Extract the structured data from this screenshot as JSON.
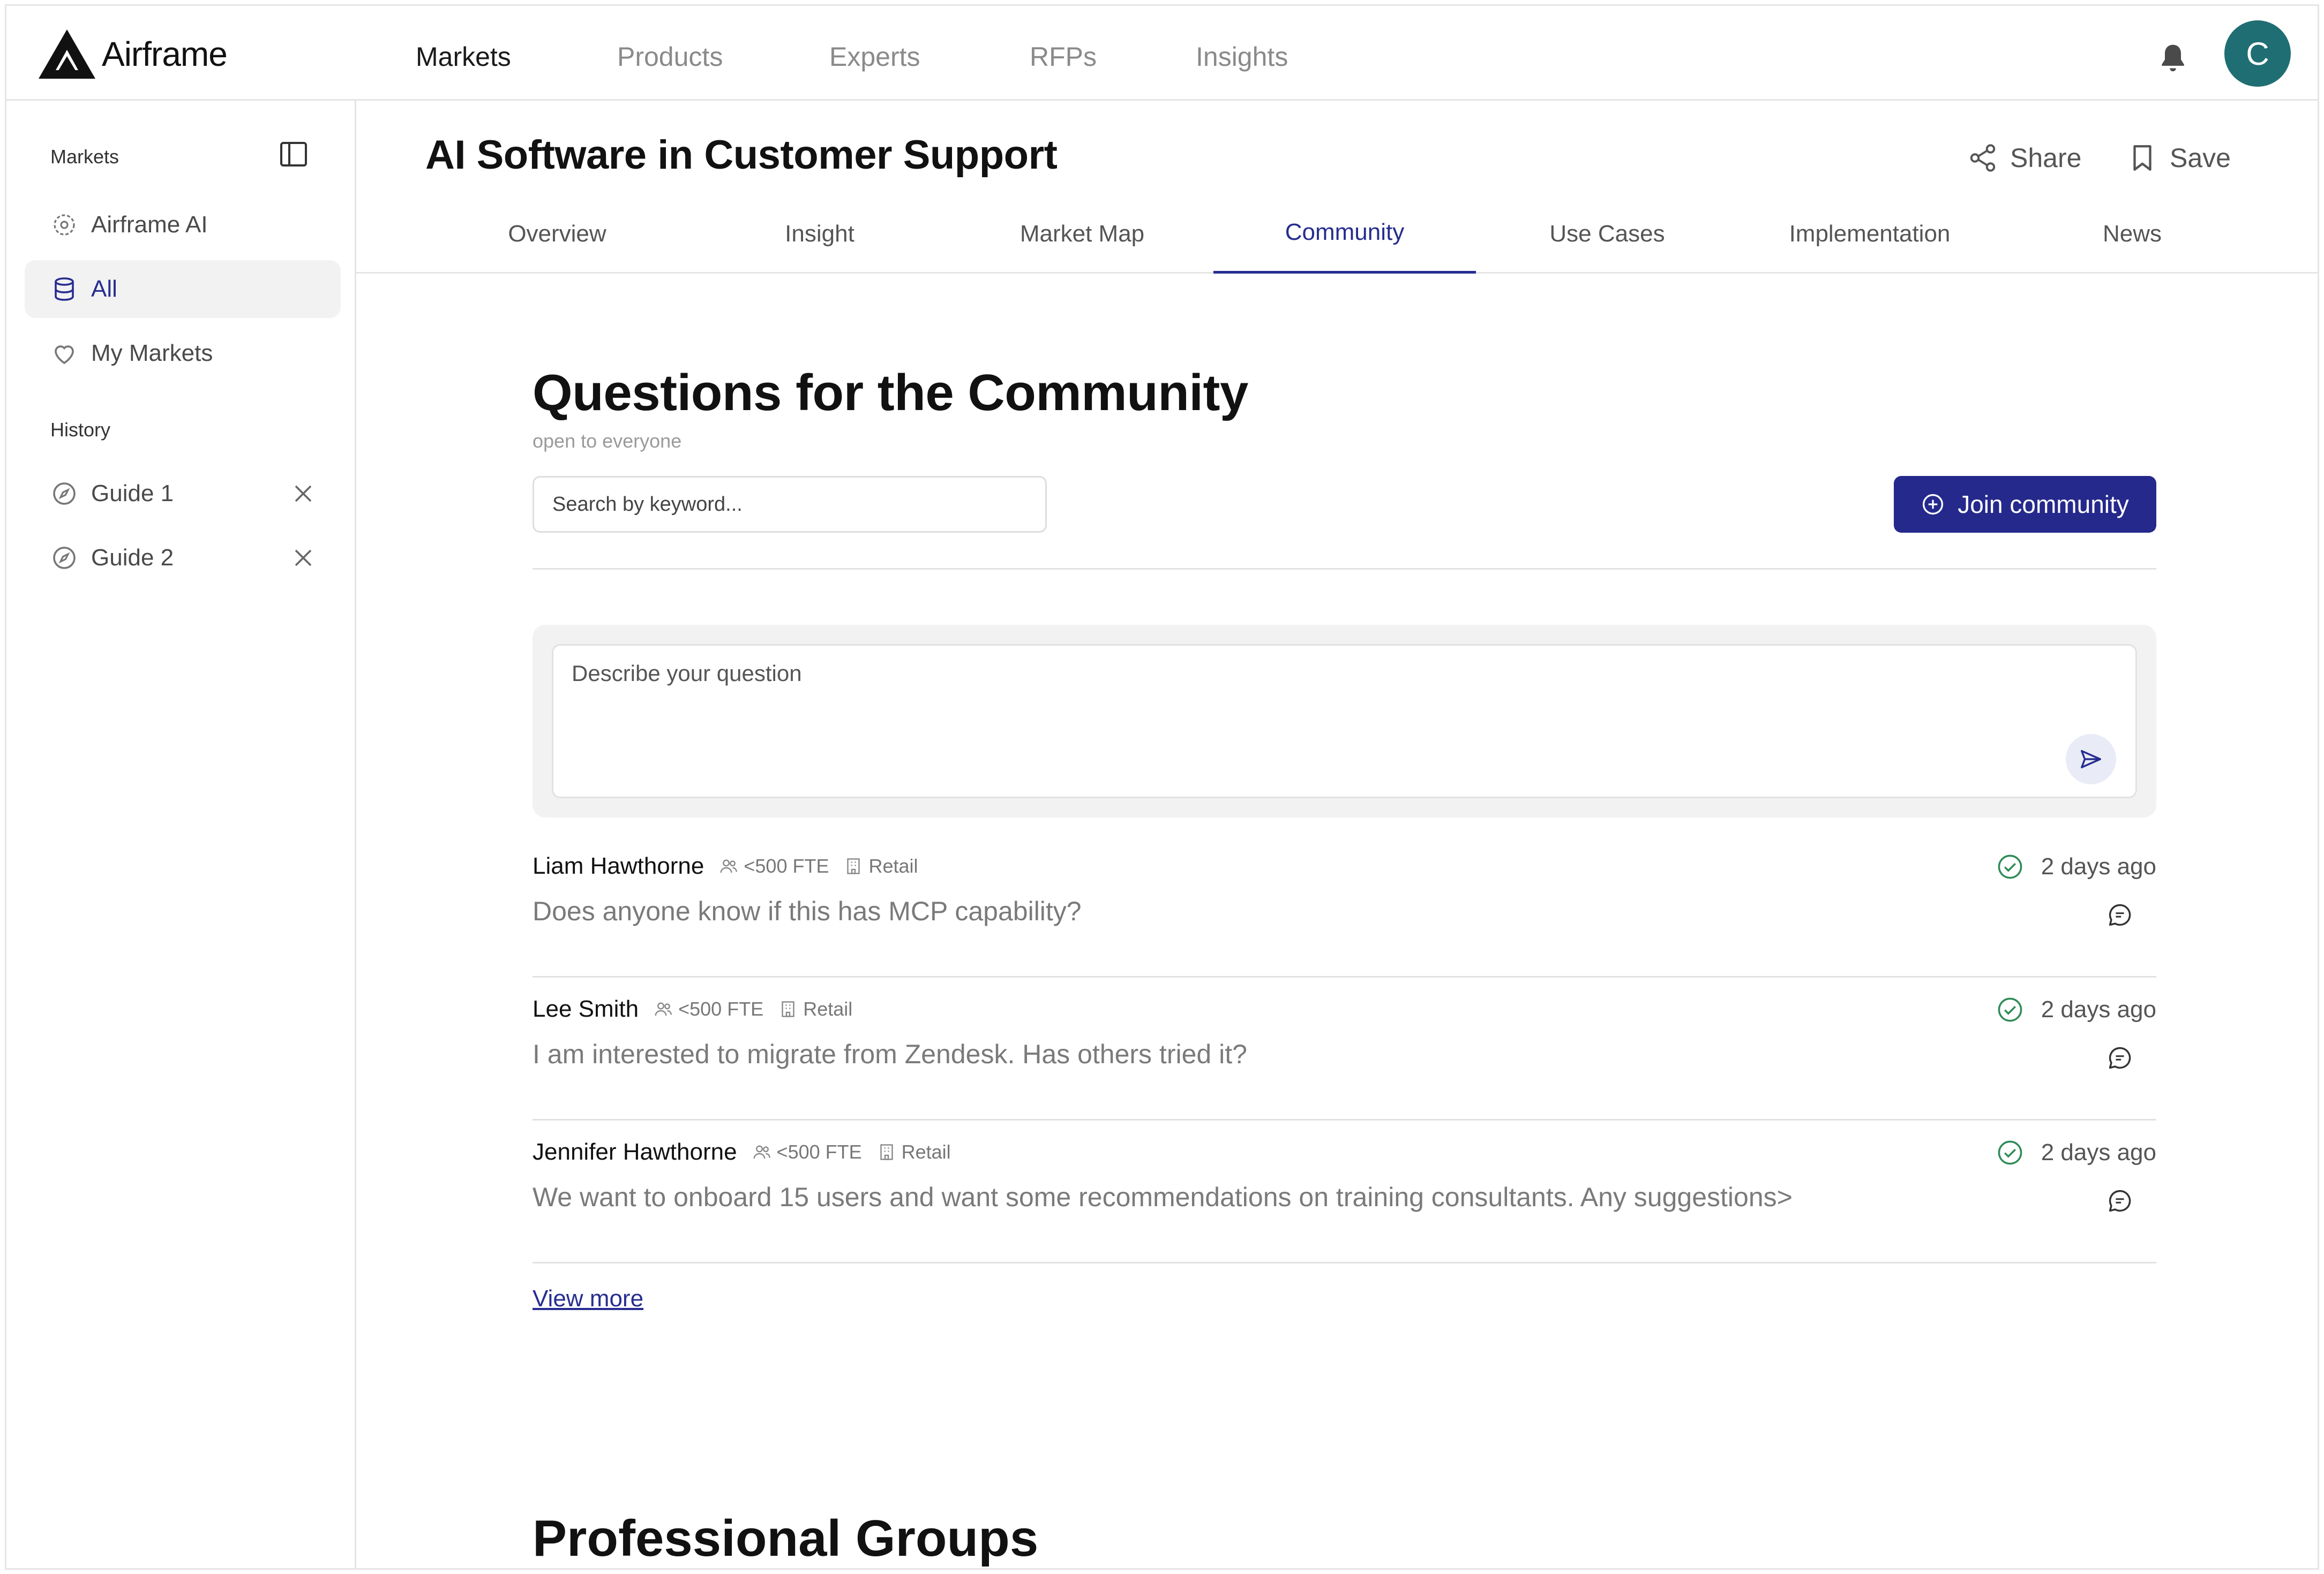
{
  "app": {
    "name": "Airframe"
  },
  "nav": {
    "items": [
      {
        "label": "Markets",
        "active": true
      },
      {
        "label": "Products",
        "active": false
      },
      {
        "label": "Experts",
        "active": false
      },
      {
        "label": "RFPs",
        "active": false
      },
      {
        "label": "Insights",
        "active": false
      }
    ]
  },
  "user": {
    "avatar_initial": "C",
    "avatar_color": "#1f6e73"
  },
  "sidebar": {
    "markets_heading": "Markets",
    "items": [
      {
        "label": "Airframe AI",
        "icon": "sparkle-circle-icon",
        "selected": false
      },
      {
        "label": "All",
        "icon": "database-icon",
        "selected": true
      },
      {
        "label": "My Markets",
        "icon": "heart-icon",
        "selected": false
      }
    ],
    "history_heading": "History",
    "history": [
      {
        "label": "Guide 1",
        "icon": "compass-icon"
      },
      {
        "label": "Guide 2",
        "icon": "compass-icon"
      }
    ]
  },
  "page": {
    "title": "AI Software in Customer Support",
    "share_label": "Share",
    "save_label": "Save"
  },
  "tabs": [
    {
      "label": "Overview",
      "active": false
    },
    {
      "label": "Insight",
      "active": false
    },
    {
      "label": "Market Map",
      "active": false
    },
    {
      "label": "Community",
      "active": true
    },
    {
      "label": "Use Cases",
      "active": false
    },
    {
      "label": "Implementation",
      "active": false
    },
    {
      "label": "News",
      "active": false
    }
  ],
  "community": {
    "title": "Questions for the Community",
    "subtitle": "open to everyone",
    "search_placeholder": "Search by keyword...",
    "join_label": "Join community",
    "composer_placeholder": "Describe your question",
    "questions": [
      {
        "author": "Liam Hawthorne",
        "size": "<500 FTE",
        "industry": "Retail",
        "time": "2 days ago",
        "text": "Does anyone know if this has MCP capability?"
      },
      {
        "author": "Lee Smith",
        "size": "<500 FTE",
        "industry": "Retail",
        "time": "2 days ago",
        "text": "I am interested to migrate from Zendesk. Has others tried it?"
      },
      {
        "author": "Jennifer Hawthorne",
        "size": "<500 FTE",
        "industry": "Retail",
        "time": "2 days ago",
        "text": "We want to onboard 15 users and want some recommendations on training consultants. Any suggestions>"
      }
    ],
    "view_more_label": "View more"
  },
  "professional_groups": {
    "title": "Professional Groups"
  },
  "colors": {
    "accent": "#25298c",
    "check_green": "#2e8b57",
    "border": "#e5e5e5"
  }
}
